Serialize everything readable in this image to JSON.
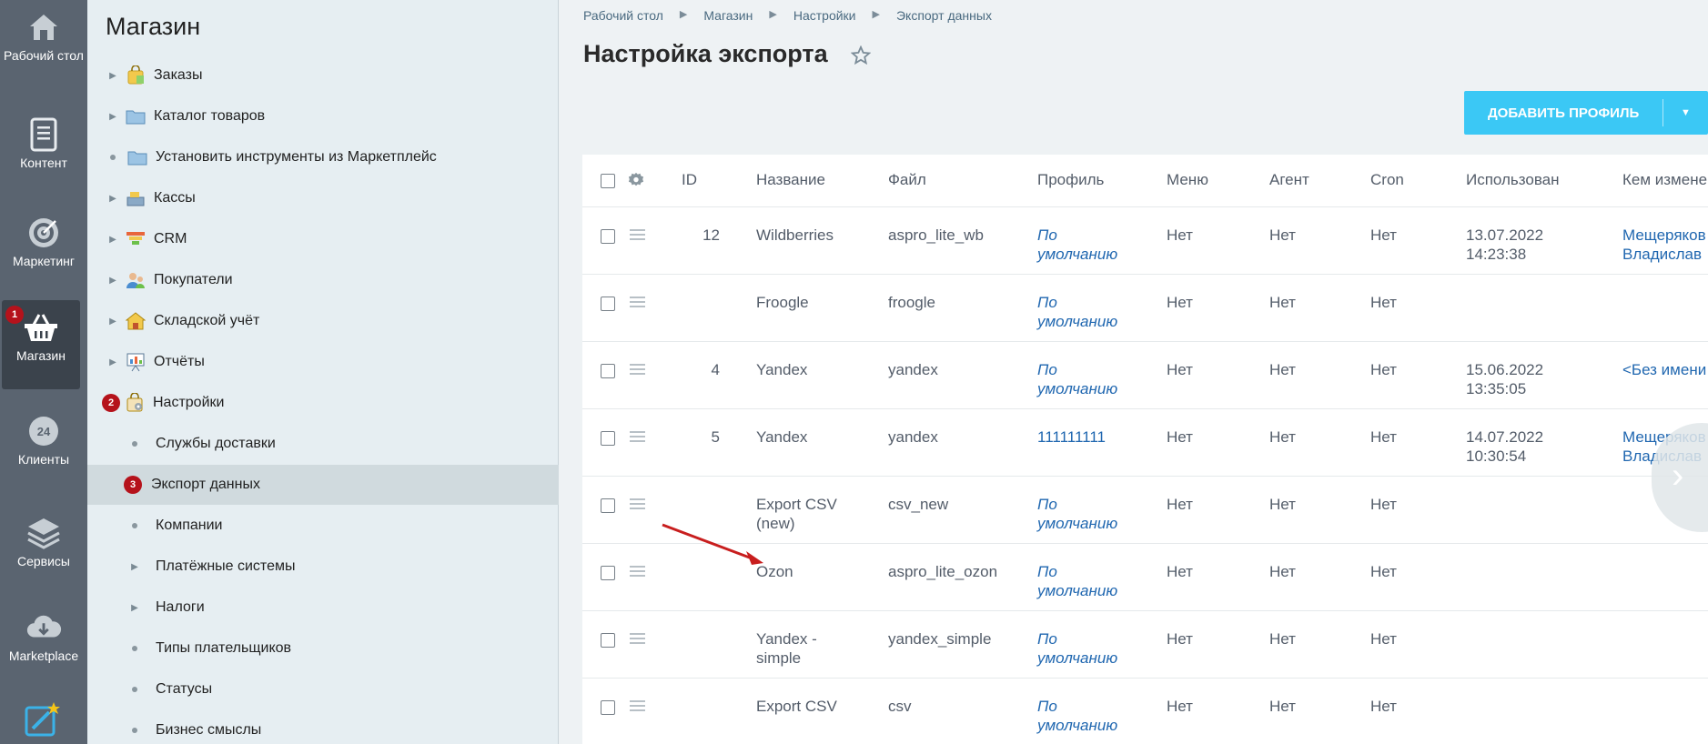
{
  "sidebar_icons": [
    {
      "label": "Рабочий стол",
      "icon": "home-icon"
    },
    {
      "label": "Контент",
      "icon": "document-icon"
    },
    {
      "label": "Маркетинг",
      "icon": "target-icon"
    },
    {
      "label": "Магазин",
      "icon": "basket-icon",
      "badge": "1",
      "active": true
    },
    {
      "label": "Клиенты",
      "icon": "clock-24-icon"
    },
    {
      "label": "Сервисы",
      "icon": "layers-icon"
    },
    {
      "label": "Marketplace",
      "icon": "cloud-download-icon"
    }
  ],
  "menu": {
    "title": "Магазин",
    "items": [
      {
        "label": "Заказы",
        "icon": "orders-bag-icon"
      },
      {
        "label": "Каталог товаров",
        "icon": "folder-icon"
      },
      {
        "label": "Установить инструменты из Маркетплейс",
        "icon": "folder-icon"
      },
      {
        "label": "Кассы",
        "icon": "cash-register-icon"
      },
      {
        "label": "CRM",
        "icon": "funnel-icon"
      },
      {
        "label": "Покупатели",
        "icon": "users-icon"
      },
      {
        "label": "Складской учёт",
        "icon": "warehouse-icon"
      },
      {
        "label": "Отчёты",
        "icon": "report-icon"
      },
      {
        "label": "Настройки",
        "icon": "settings-bag-icon",
        "badge": "2"
      },
      {
        "label": "Службы доставки"
      },
      {
        "label": "Экспорт данных",
        "badge": "3"
      },
      {
        "label": "Компании"
      },
      {
        "label": "Платёжные системы"
      },
      {
        "label": "Налоги"
      },
      {
        "label": "Типы плательщиков"
      },
      {
        "label": "Статусы"
      },
      {
        "label": "Бизнес смыслы"
      }
    ]
  },
  "breadcrumb": [
    "Рабочий стол",
    "Магазин",
    "Настройки",
    "Экспорт данных"
  ],
  "page_title": "Настройка экспорта",
  "add_button": "ДОБАВИТЬ ПРОФИЛЬ",
  "table": {
    "headers": [
      "ID",
      "Название",
      "Файл",
      "Профиль",
      "Меню",
      "Агент",
      "Cron",
      "Использован",
      "Кем изменен"
    ],
    "rows": [
      {
        "id": "12",
        "name": [
          "Wildberries"
        ],
        "file": "aspro_lite_wb",
        "profile": [
          "По",
          "умолчанию"
        ],
        "menu": "Нет",
        "agent": "Нет",
        "cron": "Нет",
        "used": [
          "13.07.2022",
          "14:23:38"
        ],
        "by": [
          "Мещеряков",
          "Владислав"
        ]
      },
      {
        "id": "",
        "name": [
          "Froogle"
        ],
        "file": "froogle",
        "profile": [
          "По",
          "умолчанию"
        ],
        "menu": "Нет",
        "agent": "Нет",
        "cron": "Нет",
        "used": [
          "",
          ""
        ],
        "by": [
          "",
          ""
        ]
      },
      {
        "id": "4",
        "name": [
          "Yandex"
        ],
        "file": "yandex",
        "profile": [
          "По",
          "умолчанию"
        ],
        "menu": "Нет",
        "agent": "Нет",
        "cron": "Нет",
        "used": [
          "15.06.2022",
          "13:35:05"
        ],
        "by": [
          "<Без имени",
          ""
        ]
      },
      {
        "id": "5",
        "name": [
          "Yandex"
        ],
        "file": "yandex",
        "profile": [
          "111111111",
          ""
        ],
        "menu": "Нет",
        "agent": "Нет",
        "cron": "Нет",
        "used": [
          "14.07.2022",
          "10:30:54"
        ],
        "by": [
          "Мещеряков",
          "Владислав"
        ]
      },
      {
        "id": "",
        "name": [
          "Export CSV",
          "(new)"
        ],
        "file": "csv_new",
        "profile": [
          "По",
          "умолчанию"
        ],
        "menu": "Нет",
        "agent": "Нет",
        "cron": "Нет",
        "used": [
          "",
          ""
        ],
        "by": [
          "",
          ""
        ]
      },
      {
        "id": "",
        "name": [
          "Ozon"
        ],
        "file": "aspro_lite_ozon",
        "profile": [
          "По",
          "умолчанию"
        ],
        "menu": "Нет",
        "agent": "Нет",
        "cron": "Нет",
        "used": [
          "",
          ""
        ],
        "by": [
          "",
          ""
        ]
      },
      {
        "id": "",
        "name": [
          "Yandex -",
          "simple"
        ],
        "file": "yandex_simple",
        "profile": [
          "По",
          "умолчанию"
        ],
        "menu": "Нет",
        "agent": "Нет",
        "cron": "Нет",
        "used": [
          "",
          ""
        ],
        "by": [
          "",
          ""
        ]
      },
      {
        "id": "",
        "name": [
          "Export CSV"
        ],
        "file": "csv",
        "profile": [
          "По",
          "умолчанию"
        ],
        "menu": "Нет",
        "agent": "Нет",
        "cron": "Нет",
        "used": [
          "",
          ""
        ],
        "by": [
          "",
          ""
        ]
      }
    ]
  },
  "colors": {
    "accent": "#3bc8f5",
    "badge": "#b5121b",
    "link": "#2067b0",
    "annotation_arrow": "#c81e1e"
  }
}
